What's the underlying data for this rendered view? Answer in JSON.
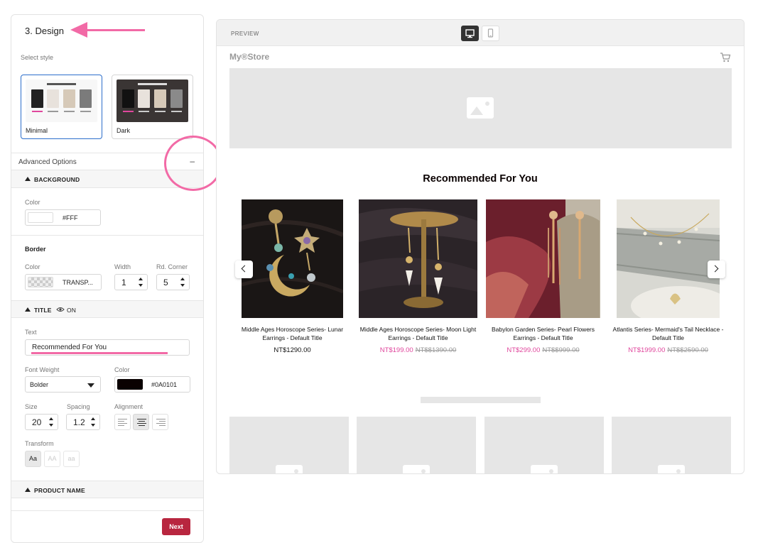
{
  "sidebar": {
    "section_title": "3. Design",
    "select_style_label": "Select style",
    "styles": [
      {
        "label": "Minimal",
        "selected": true
      },
      {
        "label": "Dark",
        "selected": false
      }
    ],
    "advanced_options_label": "Advanced Options",
    "collapse_symbol": "–",
    "background": {
      "header": "BACKGROUND",
      "color_label": "Color",
      "color_value": "#FFF"
    },
    "border": {
      "header": "Border",
      "color_label": "Color",
      "color_value": "TRANSP...",
      "width_label": "Width",
      "width_value": "1",
      "corner_label": "Rd. Corner",
      "corner_value": "5"
    },
    "title": {
      "header": "TITLE",
      "visibility": "ON",
      "text_label": "Text",
      "text_value": "Recommended For You",
      "font_weight_label": "Font Weight",
      "font_weight_value": "Bolder",
      "color_label": "Color",
      "color_value": "#0A0101",
      "size_label": "Size",
      "size_value": "20",
      "spacing_label": "Spacing",
      "spacing_value": "1.2",
      "alignment_label": "Alignment",
      "alignment_selected": "center",
      "transform_label": "Transform",
      "transform_options": [
        "Aa",
        "AA",
        "aa"
      ]
    },
    "product_name_header": "PRODUCT NAME",
    "next_label": "Next"
  },
  "preview": {
    "label": "PREVIEW",
    "store_name": "My®Store",
    "section_title": "Recommended For You",
    "products": [
      {
        "name": "Middle Ages Horoscope Series- Lunar Earrings - Default Title",
        "price": "NT$1290.00",
        "compare_price": ""
      },
      {
        "name": "Middle Ages Horoscope Series- Moon Light Earrings - Default Title",
        "price": "NT$199.00",
        "compare_price": "NT$$1390.00"
      },
      {
        "name": "Babylon Garden Series- Pearl Flowers Earrings - Default Title",
        "price": "NT$299.00",
        "compare_price": "NT$$999.00"
      },
      {
        "name": "Atlantis Series- Mermaid's Tail Necklace - Default Title",
        "price": "NT$1999.00",
        "compare_price": "NT$$2590.00"
      }
    ]
  },
  "colors": {
    "accent": "#f26aa6",
    "next_button": "#b8263f",
    "sale_price": "#e0479d",
    "title_color": "#0A0101",
    "selected_border": "#2c6ecb"
  },
  "icons": [
    "arrow-left-annotation-icon",
    "eye-icon",
    "desktop-icon",
    "mobile-icon",
    "cart-icon",
    "image-placeholder-icon",
    "chevron-left-icon",
    "chevron-right-icon"
  ]
}
